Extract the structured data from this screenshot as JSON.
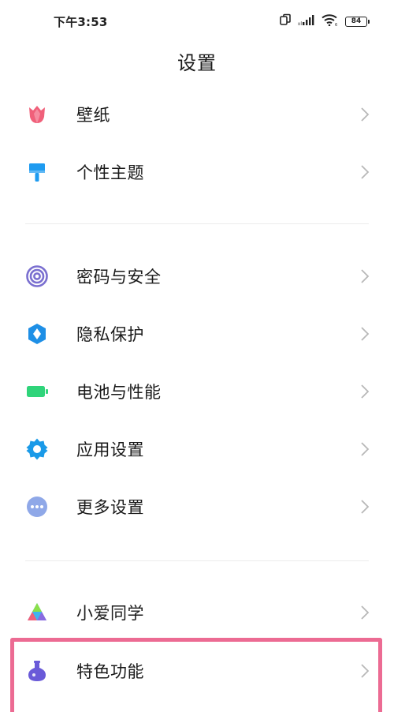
{
  "status_bar": {
    "time": "下午3:53",
    "battery": "84"
  },
  "header": {
    "title": "设置"
  },
  "groups": [
    {
      "items": [
        {
          "label": "壁纸",
          "icon": "tulip-icon",
          "color": "#f0607a"
        },
        {
          "label": "个性主题",
          "icon": "paint-brush-icon",
          "color": "#1e9bf0"
        }
      ]
    },
    {
      "items": [
        {
          "label": "密码与安全",
          "icon": "fingerprint-icon",
          "color": "#7a6fd0"
        },
        {
          "label": "隐私保护",
          "icon": "privacy-shield-icon",
          "color": "#1e8fe6"
        },
        {
          "label": "电池与性能",
          "icon": "battery-icon",
          "color": "#2fd47a"
        },
        {
          "label": "应用设置",
          "icon": "gear-icon",
          "color": "#1a9ae8"
        },
        {
          "label": "更多设置",
          "icon": "more-dots-icon",
          "color": "#8fa8e8"
        }
      ]
    },
    {
      "items": [
        {
          "label": "小爱同学",
          "icon": "xiaoai-icon",
          "color": "#3fb5f0"
        },
        {
          "label": "特色功能",
          "icon": "flask-icon",
          "color": "#6a5ad8"
        }
      ]
    }
  ],
  "highlight": {
    "color": "#ec6b93",
    "target": "特色功能"
  }
}
